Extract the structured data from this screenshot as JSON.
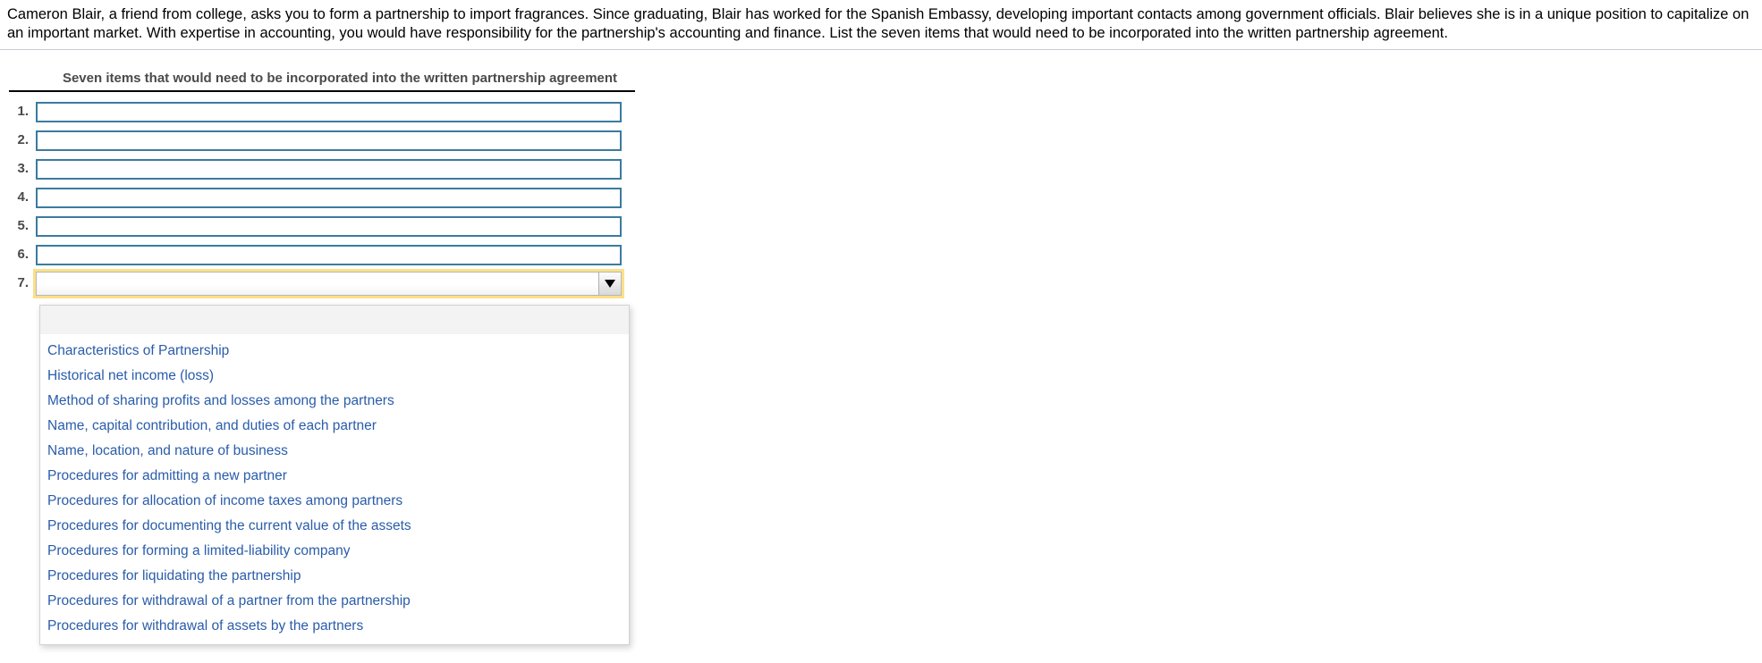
{
  "prompt": {
    "text": "Cameron Blair, a friend from college, asks you to form a partnership to import fragrances. Since graduating, Blair has worked for the Spanish Embassy, developing important contacts among government officials. Blair believes she is in a unique position to capitalize on an important market. With expertise in accounting, you would have responsibility for the partnership's accounting and finance. List the seven items that would need to be incorporated into the written partnership agreement."
  },
  "table": {
    "column_header": "Seven items that would need to be incorporated into the written partnership agreement",
    "rows": [
      {
        "number": "1.",
        "value": "",
        "placeholder": ""
      },
      {
        "number": "2.",
        "value": "",
        "placeholder": ""
      },
      {
        "number": "3.",
        "value": "",
        "placeholder": ""
      },
      {
        "number": "4.",
        "value": "",
        "placeholder": ""
      },
      {
        "number": "5.",
        "value": "",
        "placeholder": ""
      },
      {
        "number": "6.",
        "value": "",
        "placeholder": ""
      },
      {
        "number": "7.",
        "value": "",
        "placeholder": ""
      }
    ]
  },
  "dropdown": {
    "selected_value": "",
    "arrow_icon": "chevron-down-icon",
    "open": true,
    "blank_option": "",
    "options": [
      "Characteristics of Partnership",
      "Historical net income (loss)",
      "Method of sharing profits and losses among the partners",
      "Name, capital contribution, and duties of each partner",
      "Name, location, and nature of business",
      "Procedures for admitting a new partner",
      "Procedures for allocation of income taxes among partners",
      "Procedures for documenting the current value of the assets",
      "Procedures for forming a limited-liability company",
      "Procedures for liquidating the partnership",
      "Procedures for withdrawal of a partner from the partnership",
      "Procedures for withdrawal of assets by the partners"
    ]
  },
  "colors": {
    "input_border": "#3b7ba0",
    "focus_ring": "#fbe08a",
    "option_text": "#2a5caa",
    "header_text": "#4a4a4a",
    "header_rule": "#000000",
    "prompt_rule": "#c9cdd4",
    "blank_option_bg": "#f3f3f3"
  }
}
